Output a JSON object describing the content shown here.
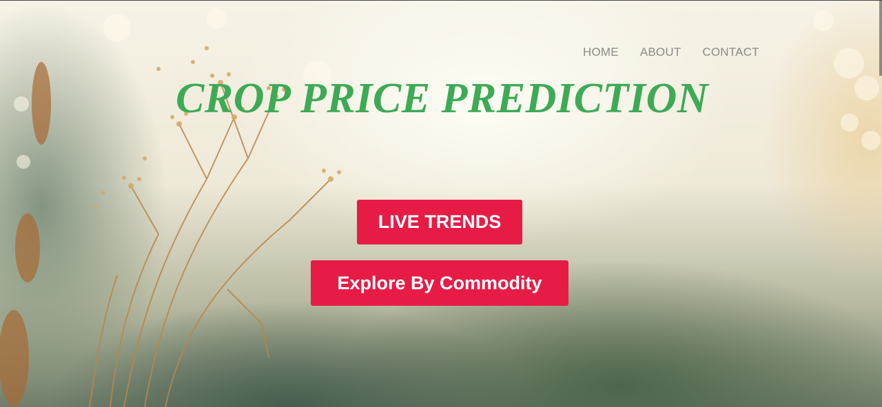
{
  "nav": {
    "items": [
      {
        "label": "HOME"
      },
      {
        "label": "ABOUT"
      },
      {
        "label": "CONTACT"
      }
    ]
  },
  "hero": {
    "title": "CROP PRICE PREDICTION",
    "title_color": "#3daa56",
    "buttons": [
      {
        "label": "LIVE TRENDS"
      },
      {
        "label": "Explore By Commodity"
      }
    ],
    "button_color": "#e61c47"
  }
}
